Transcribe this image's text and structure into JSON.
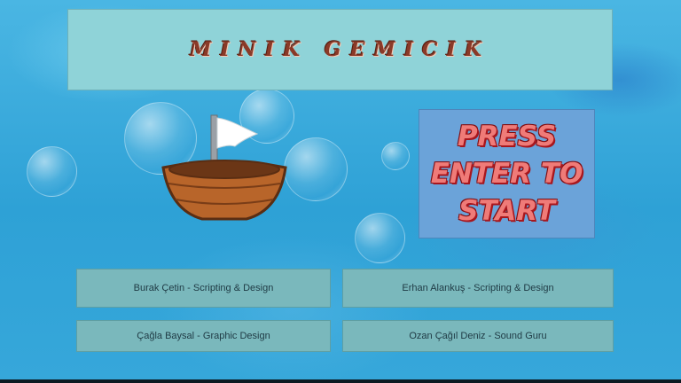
{
  "game": {
    "title": "MINIK GEMICIK",
    "start_prompt": "PRESS ENTER TO START"
  },
  "credits": [
    {
      "text": "Burak Çetin - Scripting & Design"
    },
    {
      "text": "Erhan Alankuş - Scripting & Design"
    },
    {
      "text": "Çağla Baysal - Graphic Design"
    },
    {
      "text": "Ozan Çağıl Deniz - Sound Guru"
    }
  ],
  "colors": {
    "title_panel": "#8fd3d8",
    "start_panel": "#6ba3d9",
    "credit_panel": "#7ab8bc",
    "title_text": "#8a3a28",
    "start_text": "#ef7b78"
  },
  "icons": {
    "boat": "boat-icon",
    "flag": "flag-icon"
  }
}
